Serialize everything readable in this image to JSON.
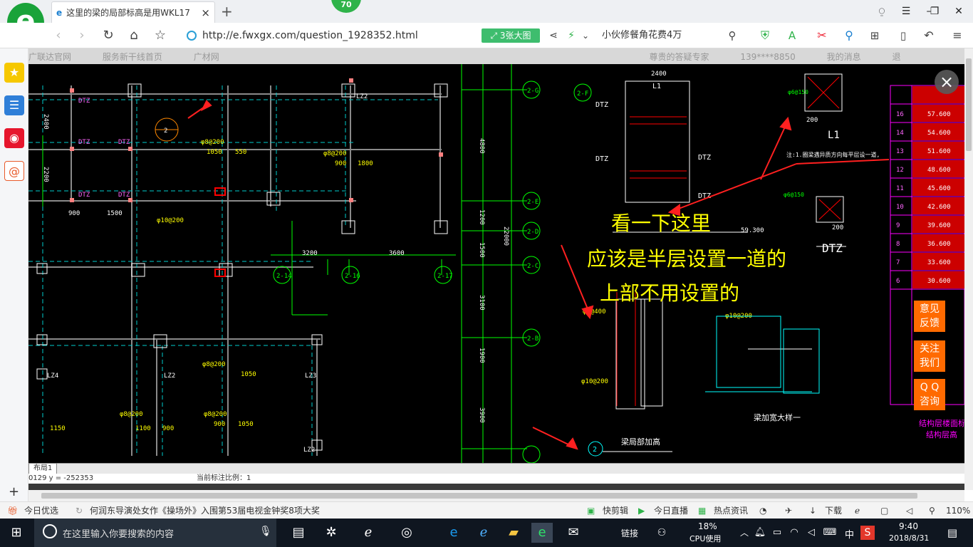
{
  "browser": {
    "tab_title": "这里的梁的局部标高是用WKL17",
    "tab_close": "×",
    "new_tab": "+",
    "badge": "70",
    "url": "http://e.fwxgx.com/question_1928352.html",
    "image_button": "3张大图",
    "search_text": "小伙修餐角花费4万",
    "zoom": "110%"
  },
  "page_behind": {
    "nav_items": [
      "广联达官网",
      "服务新干线首页",
      "广材网",
      "尊贵的答疑专家",
      "139****8850",
      "我的消息",
      "退"
    ]
  },
  "cad": {
    "layout_tab": "布局1",
    "coord_text": "0129  y = -252353",
    "scale_text": "当前标注比例：1",
    "dims": {
      "d2400": "2400",
      "d2200": "2200",
      "d900": "900",
      "d1500": "1500",
      "d3200": "3200",
      "d3600": "3600",
      "d4800": "4800",
      "d1200": "1200",
      "d22000": "22000",
      "d1500b": "1500",
      "d3100": "3100",
      "d1900": "1900",
      "d3900": "3900",
      "d1050": "1050",
      "d550": "550",
      "d1800": "1800",
      "d1100": "1100",
      "d1150": "1150",
      "d59300": "59.300",
      "d200": "200"
    },
    "labels": {
      "dtz": "DTZ",
      "lz2": "LZ2",
      "lz3": "LZ3",
      "lz4": "LZ4",
      "l1": "L1",
      "rebar1": "φ8@200",
      "rebar2": "φ10@200",
      "rebar3": "φ6@150",
      "rebar4": "φ6@400",
      "bubble_26": "2-G",
      "bubble_2f": "2-F",
      "bubble_2e": "2-E",
      "bubble_2d": "2-D",
      "bubble_2c": "2-C",
      "bubble_2b": "2-B",
      "bubble_216": "2-16",
      "bubble_217": "2-17",
      "bubble_214": "2-14",
      "detail_num": "2",
      "detail_title": "梁局部加高",
      "dtz_big": "DTZ",
      "note1": "注:1.圈梁遇异质方向每平层设一道,",
      "note2": "梁加宽大样一",
      "struct": "结构层楼面标高",
      "struct2": "结构层高"
    },
    "floor_table": {
      "rows": [
        {
          "floor": "",
          "elev": ""
        },
        {
          "floor": "16",
          "elev": "57.600"
        },
        {
          "floor": "14",
          "elev": "54.600"
        },
        {
          "floor": "13",
          "elev": "51.600"
        },
        {
          "floor": "12",
          "elev": "48.600"
        },
        {
          "floor": "11",
          "elev": "45.600"
        },
        {
          "floor": "10",
          "elev": "42.600"
        },
        {
          "floor": "9",
          "elev": "39.600"
        },
        {
          "floor": "8",
          "elev": "36.600"
        },
        {
          "floor": "7",
          "elev": "33.600"
        },
        {
          "floor": "6",
          "elev": "30.600"
        }
      ]
    }
  },
  "annotation": {
    "line1": "看一下这里",
    "line2": "应该是半层设置一道的",
    "line3": "上部不用设置的"
  },
  "viewer": {
    "close": "×",
    "feedback": [
      "意见",
      "反馈"
    ],
    "follow": [
      "关注",
      "我们"
    ],
    "qq": [
      "Q Q",
      "咨询"
    ]
  },
  "statusbar": {
    "daily": "今日优选",
    "news": "何润东导演处女作《操场外》入围第53届电视金钟奖8项大奖",
    "quickclip": "快剪辑",
    "live": "今日直播",
    "hot": "热点资讯",
    "download": "下载"
  },
  "taskbar": {
    "search_placeholder": "在这里输入你要搜索的内容",
    "link": "链接",
    "cpu_percent": "18%",
    "cpu_label": "CPU使用",
    "ime": "中",
    "time": "9:40",
    "date": "2018/8/31"
  },
  "colors": {
    "accent_green": "#1aa33a",
    "cad_bg": "#000000",
    "annotation_yellow": "#ffff00",
    "side_orange": "#ff6a00",
    "table_magenta": "#ff00ff",
    "table_red": "#cc0000"
  }
}
